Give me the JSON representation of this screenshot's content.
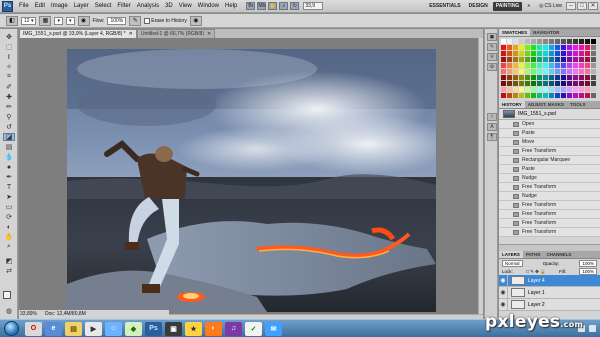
{
  "app": {
    "logo": "Ps",
    "menu": [
      "File",
      "Edit",
      "Image",
      "Layer",
      "Select",
      "Filter",
      "Analysis",
      "3D",
      "View",
      "Window",
      "Help"
    ],
    "zoom": "33,9",
    "workspaces": [
      "ESSENTIALS",
      "DESIGN",
      "PAINTING"
    ],
    "active_workspace": "PAINTING",
    "cs_live": "CS Live"
  },
  "options_bar": {
    "flow_label": "Flow:",
    "flow_value": "100%",
    "erase_to_history": "Erase to History"
  },
  "documents": {
    "tabs": [
      {
        "title": "IMG_1551_s.psd @ 33,9% (Layer 4, RGB/8) *",
        "active": true
      },
      {
        "title": "Untitled-1 @ 66,7% (RGB/8)",
        "active": false
      }
    ]
  },
  "status": {
    "zoom": "33,89%",
    "doc": "Doc: 12,4M/80,8M"
  },
  "panels": {
    "swatches_tabs": [
      "SWATCHES",
      "NAVIGATOR"
    ],
    "history_tabs": [
      "HISTORY",
      "ADJUST. MASKS",
      "TOOLS"
    ],
    "history_snapshot": "IMG_1551_s.psd",
    "history_items": [
      "Open",
      "Paste",
      "Move",
      "Free Transform",
      "Rectangular Marquee",
      "Paste",
      "Nudge",
      "Free Transform",
      "Nudge",
      "Free Transform",
      "Free Transform",
      "Free Transform",
      "Free Transform"
    ],
    "layers_tabs": [
      "LAYERS",
      "PATHS",
      "CHANNELS"
    ],
    "blend_mode": "Normal",
    "opacity_label": "Opacity:",
    "opacity_value": "100%",
    "lock_label": "Lock:",
    "fill_label": "Fill:",
    "fill_value": "100%",
    "layers": [
      {
        "name": "Layer 4",
        "active": true
      },
      {
        "name": "Layer 1",
        "active": false
      },
      {
        "name": "Layer 2",
        "active": false
      }
    ]
  },
  "watermark": {
    "text": "pxleyes",
    "suffix": ".com"
  }
}
